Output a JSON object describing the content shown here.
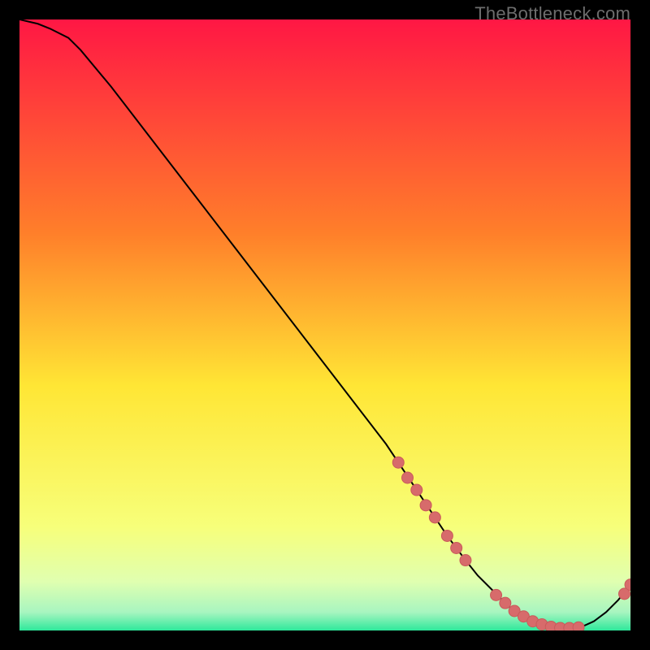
{
  "watermark": "TheBottleneck.com",
  "colors": {
    "frame_bg": "#000000",
    "curve": "#000000",
    "marker_fill": "#d76b6b",
    "marker_stroke": "#c95a5a",
    "gradient_top": "#ff1744",
    "gradient_mid_upper": "#ff7f2a",
    "gradient_mid": "#ffe635",
    "gradient_low1": "#f7ff7a",
    "gradient_low2": "#e0ffb0",
    "gradient_low3": "#a8f5c0",
    "gradient_bottom": "#2ee89b"
  },
  "chart_data": {
    "type": "line",
    "title": "",
    "xlabel": "",
    "ylabel": "",
    "xlim": [
      0,
      100
    ],
    "ylim": [
      0,
      100
    ],
    "grid": false,
    "legend": false,
    "series": [
      {
        "name": "curve",
        "x": [
          0,
          3,
          5,
          8,
          10,
          15,
          20,
          25,
          30,
          35,
          40,
          45,
          50,
          55,
          60,
          62,
          65,
          68,
          70,
          73,
          75,
          78,
          80,
          82,
          84,
          86,
          88,
          90,
          92,
          94,
          96,
          98,
          100
        ],
        "y": [
          100,
          99.3,
          98.5,
          97.0,
          95.0,
          89.0,
          82.5,
          76.0,
          69.5,
          63.0,
          56.5,
          50.0,
          43.5,
          37.0,
          30.5,
          27.5,
          23.0,
          18.5,
          15.5,
          11.5,
          9.0,
          6.0,
          4.0,
          2.6,
          1.6,
          0.9,
          0.5,
          0.4,
          0.6,
          1.5,
          3.0,
          5.0,
          7.5
        ]
      }
    ],
    "markers": [
      {
        "x": 62.0,
        "y": 27.5
      },
      {
        "x": 63.5,
        "y": 25.0
      },
      {
        "x": 65.0,
        "y": 23.0
      },
      {
        "x": 66.5,
        "y": 20.5
      },
      {
        "x": 68.0,
        "y": 18.5
      },
      {
        "x": 70.0,
        "y": 15.5
      },
      {
        "x": 71.5,
        "y": 13.5
      },
      {
        "x": 73.0,
        "y": 11.5
      },
      {
        "x": 78.0,
        "y": 5.8
      },
      {
        "x": 79.5,
        "y": 4.5
      },
      {
        "x": 81.0,
        "y": 3.2
      },
      {
        "x": 82.5,
        "y": 2.3
      },
      {
        "x": 84.0,
        "y": 1.5
      },
      {
        "x": 85.5,
        "y": 1.0
      },
      {
        "x": 87.0,
        "y": 0.6
      },
      {
        "x": 88.5,
        "y": 0.4
      },
      {
        "x": 90.0,
        "y": 0.4
      },
      {
        "x": 91.5,
        "y": 0.5
      },
      {
        "x": 99.0,
        "y": 6.0
      },
      {
        "x": 100.0,
        "y": 7.5
      }
    ]
  }
}
